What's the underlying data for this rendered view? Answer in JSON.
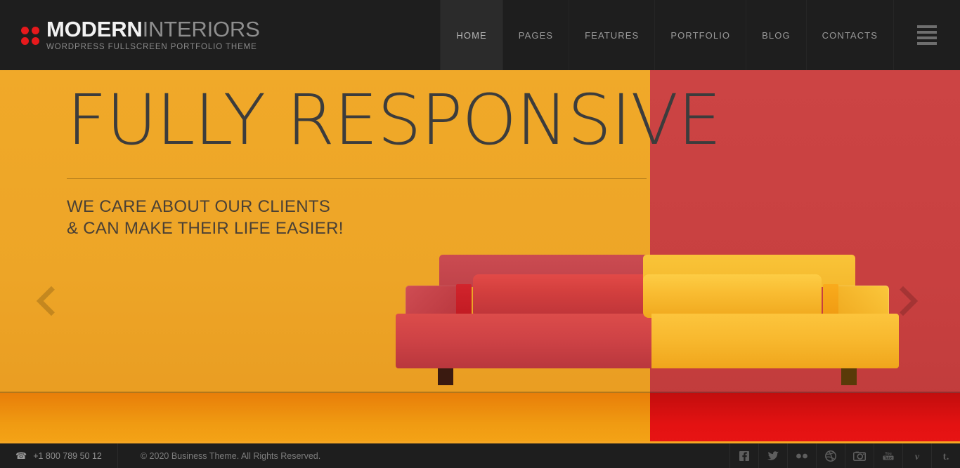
{
  "header": {
    "logo": {
      "bold": "MODERN",
      "light": "INTERIORS",
      "tagline": "WORDPRESS FULLSCREEN PORTFOLIO THEME",
      "dot_color": "#e6191c"
    },
    "nav": [
      {
        "label": "HOME",
        "active": true
      },
      {
        "label": "PAGES",
        "active": false
      },
      {
        "label": "FEATURES",
        "active": false
      },
      {
        "label": "PORTFOLIO",
        "active": false
      },
      {
        "label": "BLOG",
        "active": false
      },
      {
        "label": "CONTACTS",
        "active": false
      }
    ],
    "menu_toggle_icon": "hamburger-icon"
  },
  "hero": {
    "headline": "FULLY RESPONSIVE",
    "subline_1": "WE CARE ABOUT OUR CLIENTS",
    "subline_2": "& CAN MAKE THEIR LIFE EASIER!",
    "prev_icon": "chevron-left-icon",
    "next_icon": "chevron-right-icon",
    "colors": {
      "left_wall": "#EFA62B",
      "right_wall": "#C94040",
      "left_floor": "#F09B12",
      "right_floor": "#E31212",
      "headline_text": "#3C3C3C"
    }
  },
  "footer": {
    "phone": "+1 800 789 50 12",
    "phone_icon": "telephone-icon",
    "copyright": "© 2020 Business Theme. All Rights Reserved.",
    "accent_color": "#F5A623",
    "social": [
      {
        "name": "facebook",
        "glyph": "f"
      },
      {
        "name": "twitter",
        "glyph": "t"
      },
      {
        "name": "flickr",
        "glyph": "··"
      },
      {
        "name": "dribbble",
        "glyph": "d"
      },
      {
        "name": "instagram",
        "glyph": "i"
      },
      {
        "name": "youtube",
        "glyph": "yt"
      },
      {
        "name": "vimeo",
        "glyph": "v"
      },
      {
        "name": "tumblr",
        "glyph": "t."
      }
    ]
  }
}
